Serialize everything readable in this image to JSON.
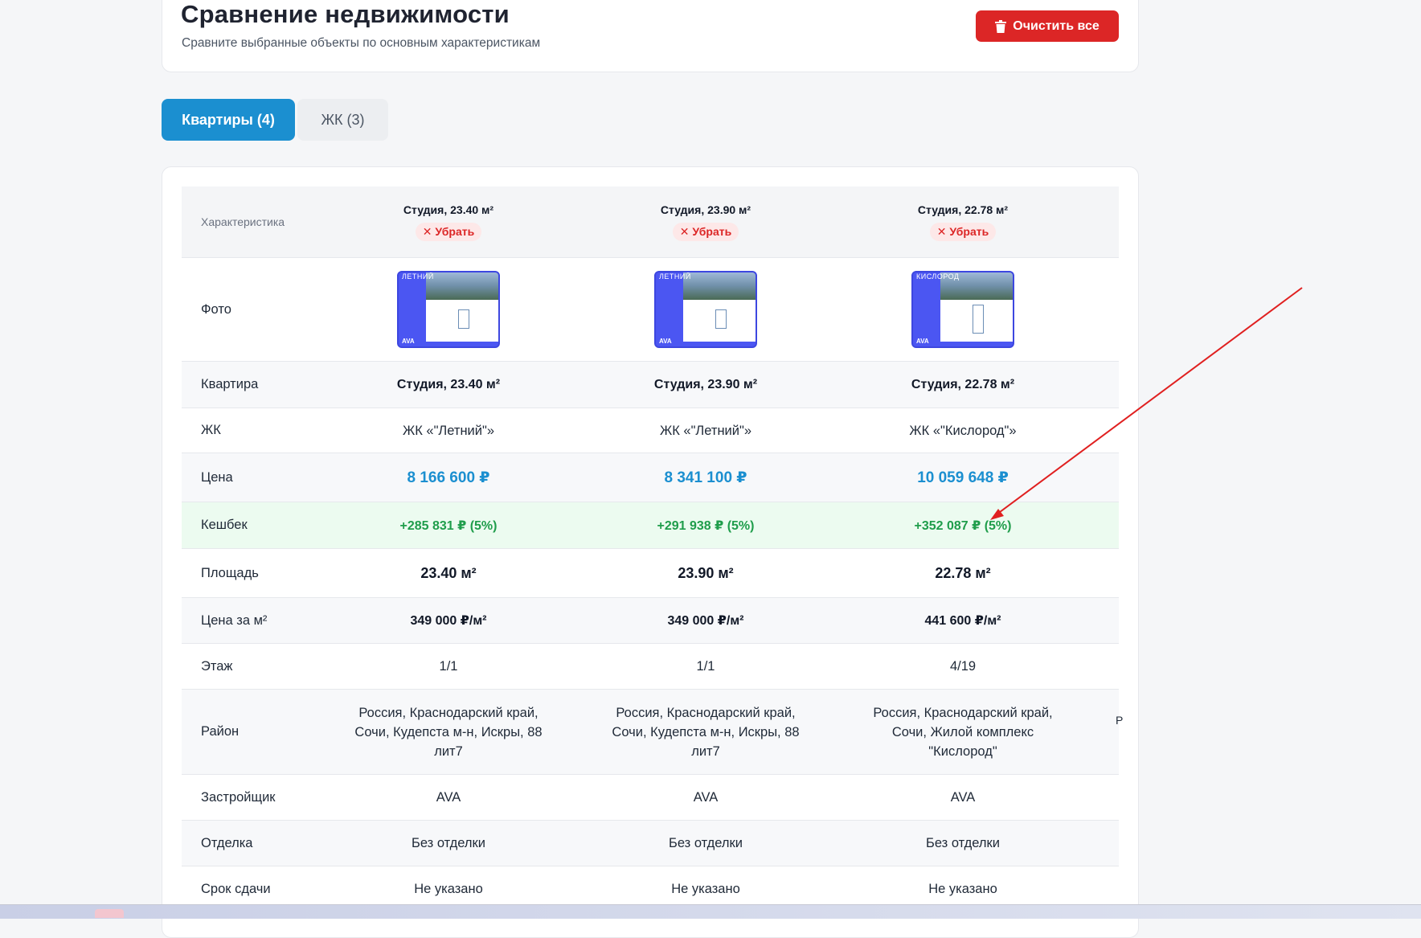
{
  "header": {
    "title": "Сравнение недвижимости",
    "subtitle": "Сравните выбранные объекты по основным характеристикам",
    "clear_label": "Очистить все"
  },
  "tabs": [
    {
      "label": "Квартиры (4)",
      "active": true
    },
    {
      "label": "ЖК (3)",
      "active": false
    }
  ],
  "table": {
    "header_label": "Характеристика",
    "remove_label": "✕ Убрать",
    "columns": [
      {
        "title": "Студия, 23.40 м²",
        "photo_tag": "ЛЕТНИЙ",
        "photo_brand": "AVA",
        "apartment": "Студия, 23.40 м²",
        "complex": "ЖК «\"Летний\"»",
        "price": "8 166 600 ₽",
        "cashback": "+285 831 ₽ (5%)",
        "area": "23.40 м²",
        "price_per_m2": "349 000 ₽/м²",
        "floor": "1/1",
        "district": "Россия, Краснодарский край, Сочи, Кудепста м-н, Искры, 88 лит7",
        "developer": "AVA",
        "finish": "Без отделки",
        "deadline": "Не указано"
      },
      {
        "title": "Студия, 23.90 м²",
        "photo_tag": "ЛЕТНИЙ",
        "photo_brand": "AVA",
        "apartment": "Студия, 23.90 м²",
        "complex": "ЖК «\"Летний\"»",
        "price": "8 341 100 ₽",
        "cashback": "+291 938 ₽ (5%)",
        "area": "23.90 м²",
        "price_per_m2": "349 000 ₽/м²",
        "floor": "1/1",
        "district": "Россия, Краснодарский край, Сочи, Кудепста м-н, Искры, 88 лит7",
        "developer": "AVA",
        "finish": "Без отделки",
        "deadline": "Не указано"
      },
      {
        "title": "Студия, 22.78 м²",
        "photo_tag": "КИСЛОРОД",
        "photo_brand": "AVA",
        "apartment": "Студия, 22.78 м²",
        "complex": "ЖК «\"Кислород\"»",
        "price": "10 059 648 ₽",
        "cashback": "+352 087 ₽ (5%)",
        "area": "22.78 м²",
        "price_per_m2": "441 600 ₽/м²",
        "floor": "4/19",
        "district": "Россия, Краснодарский край, Сочи, Жилой комплекс \"Кислород\"",
        "developer": "AVA",
        "finish": "Без отделки",
        "deadline": "Не указано"
      }
    ],
    "rows": {
      "photo": "Фото",
      "apartment": "Квартира",
      "complex": "ЖК",
      "price": "Цена",
      "cashback": "Кешбек",
      "area": "Площадь",
      "price_per_m2": "Цена за м²",
      "floor": "Этаж",
      "district": "Район",
      "developer": "Застройщик",
      "finish": "Отделка",
      "deadline": "Срок сдачи"
    },
    "edge_glyph": "Р"
  },
  "colors": {
    "accent": "#1b8fd0",
    "danger": "#dc2626",
    "cashback": "#1f9d4b",
    "annotation_arrow": "#e02020"
  }
}
